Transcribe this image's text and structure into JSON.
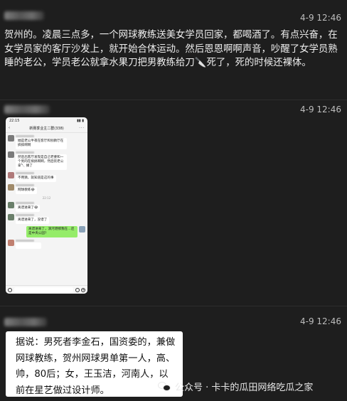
{
  "messages": [
    {
      "time": "4-9 12:46",
      "text": "贺州的。凌晨三点多，一个网球教练送美女学员回家，都喝酒了。有点兴奋，在女学员家的客厅沙发上，就开始合体运动。然后恩恩啊啊声音，吵醒了女学员熟睡的老公，学员老公就拿水果刀把男教练给刀🔪死了，死的时候还裸体。"
    },
    {
      "time": "4-9 12:46",
      "screenshot": {
        "status_time": "22:15",
        "status_icons": "▮▮ ▮",
        "nav_back": "‹",
        "nav_title": "新赛季业主二群(338)",
        "nav_more": "···",
        "time_divider": "22:12",
        "bubbles": [
          {
            "side": "left",
            "text": "她是老公半夜在客厅和别教厅在搞搞啊啊"
          },
          {
            "side": "left",
            "text": "然后出客厅发现是自己老婆和一个男的在搞搞啊啊，然后装老公拿🔪 捅了"
          },
          {
            "side": "left",
            "text": "不用猜，就知道是这的事"
          },
          {
            "side": "left",
            "text": "网球教练😂"
          },
          {
            "side": "left",
            "text": "离谱进来了😂"
          },
          {
            "side": "left",
            "text": "离谱进来了，没谱了"
          },
          {
            "side": "right",
            "text": "离谱进来了，演河港那我在…还是中央公园?"
          },
          {
            "side": "left",
            "text": ""
          }
        ]
      }
    },
    {
      "time": "4-9 12:46",
      "text": "据说：男死者李金石，国资委的，兼做网球教练，贺州网球男单第一人，高、帅，80后；女，王玉洁，河南人，以前在星艺做过设计师。"
    }
  ],
  "watermark": "公众号 · 卡卡的瓜田网络吃瓜之家",
  "watermark_icon": "wechat-icon"
}
